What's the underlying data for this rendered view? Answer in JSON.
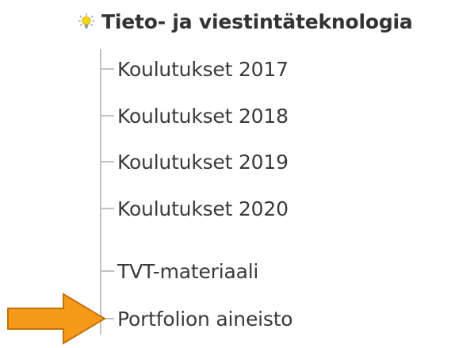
{
  "nav": {
    "header": {
      "icon": "lightbulb-icon",
      "title": "Tieto- ja viestintäteknologia"
    },
    "items": [
      {
        "label": "Koulutukset 2017"
      },
      {
        "label": "Koulutukset 2018"
      },
      {
        "label": "Koulutukset 2019"
      },
      {
        "label": "Koulutukset 2020"
      },
      {
        "label": "TVT-materiaali"
      },
      {
        "label": "Portfolion aineisto"
      }
    ]
  },
  "annotation": {
    "arrow_icon": "arrow-right-icon",
    "arrow_color": "#f59a18",
    "arrow_stroke": "#c4710a",
    "points_to": "Portfolion aineisto"
  },
  "colors": {
    "text": "#333333",
    "tree_line": "#c2c2c2",
    "bulb_yellow": "#f5d90e"
  }
}
